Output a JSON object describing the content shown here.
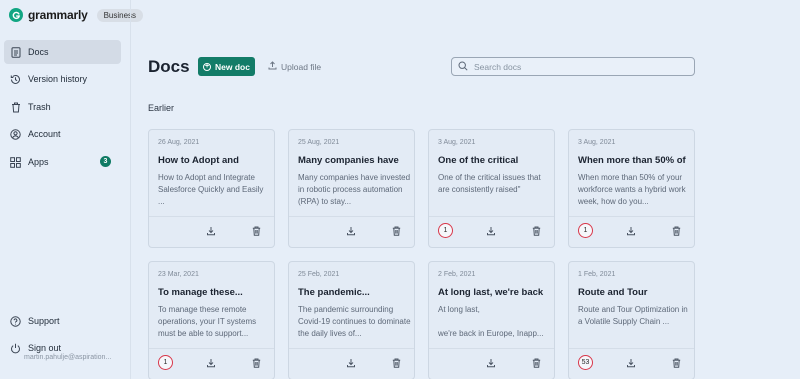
{
  "app": {
    "brand": "grammarly",
    "plan_badge": "Business",
    "brand_color": "#11a683"
  },
  "sidebar": {
    "items": [
      {
        "label": "Docs",
        "icon": "doc-icon",
        "active": true
      },
      {
        "label": "Version history",
        "icon": "history-icon"
      },
      {
        "label": "Trash",
        "icon": "trash-icon"
      },
      {
        "label": "Account",
        "icon": "account-icon"
      },
      {
        "label": "Apps",
        "icon": "apps-icon",
        "count": "3"
      }
    ],
    "bottom": [
      {
        "label": "Support",
        "icon": "help-icon"
      },
      {
        "label": "Sign out",
        "icon": "power-icon"
      }
    ],
    "user_email": "martin.pahulje@aspiration..."
  },
  "main": {
    "title": "Docs",
    "new_doc_label": "New doc",
    "upload_label": "Upload file",
    "search_placeholder": "Search docs",
    "section_label": "Earlier"
  },
  "cards": [
    {
      "date": "26 Aug, 2021",
      "title": "How to Adopt and",
      "snippet": "How to Adopt and Integrate Salesforce Quickly and Easily ...",
      "score": ""
    },
    {
      "date": "25 Aug, 2021",
      "title": "Many companies have",
      "snippet": "Many companies have invested in robotic process automation (RPA) to stay...",
      "score": ""
    },
    {
      "date": "3 Aug, 2021",
      "title": "One of the critical",
      "snippet": "One of the critical issues that are consistently raised\"",
      "score": "1"
    },
    {
      "date": "3 Aug, 2021",
      "title": "When more than 50% of",
      "snippet": "When more than 50% of your workforce wants a hybrid work week, how do you...",
      "score": "1"
    },
    {
      "date": "23 Mar, 2021",
      "title": "To manage these...",
      "snippet": "To manage these remote operations, your IT systems must be able to support...",
      "score": "1"
    },
    {
      "date": "25 Feb, 2021",
      "title": "The pandemic...",
      "snippet": "The pandemic surrounding Covid-19 continues to dominate the daily lives of...",
      "score": ""
    },
    {
      "date": "2 Feb, 2021",
      "title": "At long last, we're back",
      "snippet": "At long last,\n\nwe're back in Europe, Inapp...",
      "score": ""
    },
    {
      "date": "1 Feb, 2021",
      "title": "Route and Tour",
      "snippet": "Route and Tour Optimization in a Volatile Supply Chain ...",
      "score": "53"
    }
  ]
}
